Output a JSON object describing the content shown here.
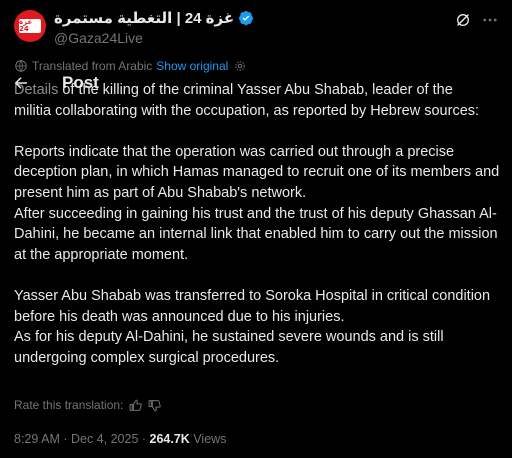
{
  "author": {
    "display_name": "غزة 24 | التغطية مستمرة",
    "handle": "@Gaza24Live",
    "avatar_text": "غزة 24",
    "verified": true
  },
  "header": {
    "title": "Post"
  },
  "translation": {
    "label": "Translated from Arabic",
    "show_original": "Show original",
    "rate_label": "Rate this translation:"
  },
  "body": {
    "line1_faded": "Details",
    "line1_rest": " of the killing of the criminal Yasser Abu Shabab, leader of the",
    "line2": "militia collaborating with the occupation, as reported by Hebrew sources:",
    "para2": "Reports indicate that the operation was carried out through a precise deception plan, in which Hamas managed to recruit one of its members and present him as part of Abu Shabab's network.\nAfter succeeding in gaining his trust and the trust of his deputy Ghassan Al-Dahini, he became an internal link that enabled him to carry out the mission at the appropriate moment.",
    "para3": "Yasser Abu Shabab was transferred to Soroka Hospital in critical condition before his death was announced due to his injuries.\nAs for his deputy Al-Dahini, he sustained severe wounds and is still undergoing complex surgical procedures."
  },
  "meta": {
    "time": "8:29 AM",
    "date": "Dec 4, 2025",
    "separator": " · ",
    "views_count": "264.7K",
    "views_label": " Views"
  },
  "colors": {
    "background": "#000000",
    "text": "#e7e9ea",
    "muted": "#71767b",
    "link": "#1d9bf0",
    "verified": "#1d9bf0",
    "avatar_bg": "#e0191f"
  },
  "icons": {
    "verified": "verified-badge-icon",
    "grok": "grok-icon",
    "more": "more-dots-icon",
    "back": "back-arrow-icon",
    "translate": "translate-icon",
    "settings": "gear-icon",
    "thumbs_up": "thumbs-up-icon",
    "thumbs_down": "thumbs-down-icon"
  }
}
